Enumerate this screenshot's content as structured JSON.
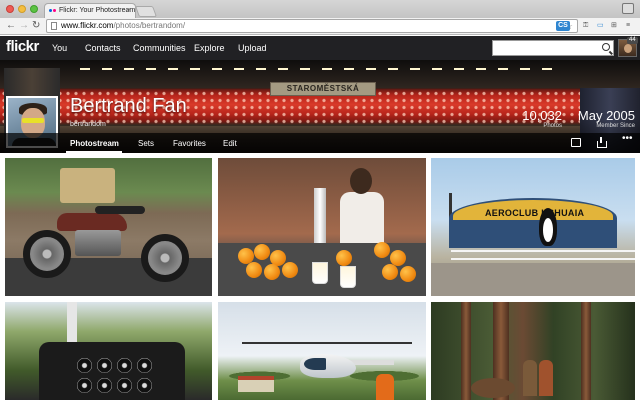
{
  "browser": {
    "tab_title": "Flickr: Your Photostream",
    "tab_close": "×",
    "url_host": "www.flickr.com",
    "url_path": "/photos/bertrandom/",
    "nav_back": "←",
    "nav_forward": "→",
    "nav_reload": "↻",
    "bookmark_icon": "☆",
    "extensions": [
      "CS",
      "⚿",
      "▭",
      "⊞",
      "≡"
    ]
  },
  "flickr_nav": {
    "logo": "flickr",
    "items": [
      "You",
      "Contacts",
      "Communities",
      "Explore",
      "Upload"
    ],
    "search_placeholder": "",
    "notification_count": "44"
  },
  "profile": {
    "name": "Bertrand Fan",
    "username": "bertrandom",
    "photos_count": "10,032",
    "photos_label": "Photos",
    "member_since": "May 2005",
    "member_since_label": "Member Since",
    "cover_sign": "STAROMĚSTSKÁ"
  },
  "subnav": {
    "items": [
      "Photostream",
      "Sets",
      "Favorites",
      "Edit"
    ],
    "active": "Photostream",
    "more_icon": "•••"
  },
  "photos": {
    "hangar_sign": "AEROCLUB USHUAIA"
  },
  "colors": {
    "nav_bg": "#212124",
    "flickr_blue": "#0063dc",
    "flickr_pink": "#ff0084"
  }
}
